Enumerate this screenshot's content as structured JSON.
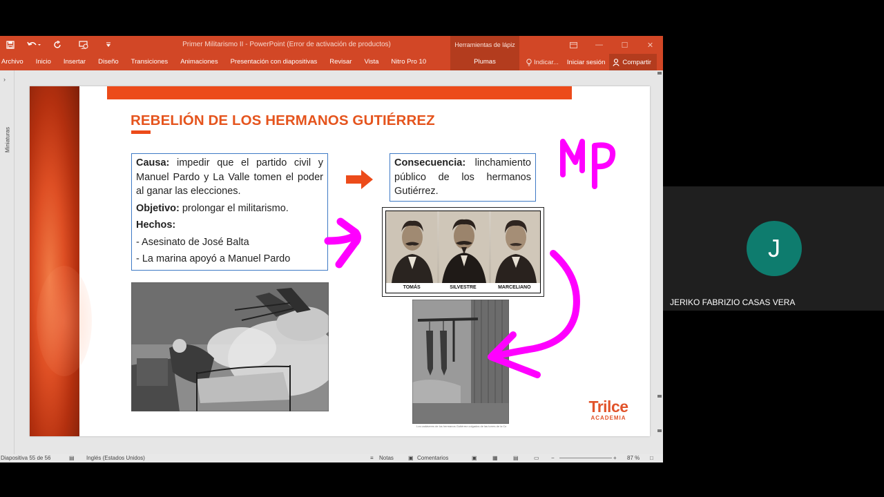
{
  "app": {
    "window_title": "Primer Militarismo II - PowerPoint (Error de activación de productos)",
    "context_tab_group": "Herramientas de lápiz",
    "context_tab": "Plumas"
  },
  "ribbon": {
    "tabs": [
      "Archivo",
      "Inicio",
      "Insertar",
      "Diseño",
      "Transiciones",
      "Animaciones",
      "Presentación con diapositivas",
      "Revisar",
      "Vista",
      "Nitro Pro 10"
    ],
    "tell_me": "Indicar...",
    "sign_in": "Iniciar sesión",
    "share": "Compartir"
  },
  "sidebar": {
    "thumbnails_label": "Miniaturas"
  },
  "slide": {
    "title": "REBELIÓN DE LOS HERMANOS GUTIÉRREZ",
    "cause_label": "Causa:",
    "cause_text": " impedir que el partido civil y Manuel Pardo y La Valle tomen el poder al ganar las elecciones.",
    "objective_label": "Objetivo:",
    "objective_text": " prolongar el militarismo.",
    "facts_label": "Hechos:",
    "facts": [
      "- Asesinato de José Balta",
      "- La marina apoyó a Manuel Pardo"
    ],
    "consequence_label": "Consecuencia:",
    "consequence_text": " linchamiento público de los hermanos Gutiérrez.",
    "brothers": [
      "TOMÁS",
      "SILVESTRE",
      "MARCELIANO"
    ],
    "engraving_caption": "Los cadáveres de los hermanos Gutiérrez colgados de las torres de la Catedral.",
    "logo_name": "Trilce",
    "logo_sub": "ACADEMIA",
    "ink_annotation": "MP"
  },
  "statusbar": {
    "slide_counter": "Diapositiva 55 de 56",
    "language": "Inglés (Estados Unidos)",
    "notes": "Notas",
    "comments": "Comentarios",
    "zoom": "87 %"
  },
  "meeting": {
    "participant_initial": "J",
    "participant_name": "JERIKO FABRIZIO CASAS VERA"
  },
  "colors": {
    "ppt_accent": "#d24726",
    "slide_orange": "#ec4b1a",
    "box_border": "#3d79c5",
    "ink_magenta": "#ff00ff",
    "avatar": "#0e7c6e"
  }
}
